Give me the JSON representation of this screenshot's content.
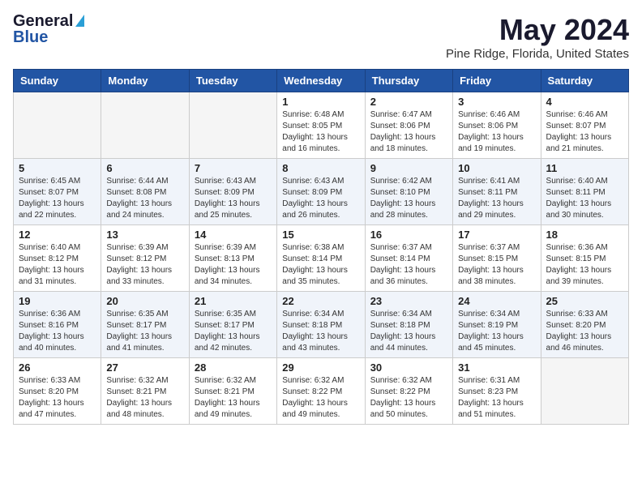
{
  "header": {
    "logo_general": "General",
    "logo_blue": "Blue",
    "month_title": "May 2024",
    "location": "Pine Ridge, Florida, United States"
  },
  "weekdays": [
    "Sunday",
    "Monday",
    "Tuesday",
    "Wednesday",
    "Thursday",
    "Friday",
    "Saturday"
  ],
  "weeks": [
    [
      {
        "day": "",
        "sunrise": "",
        "sunset": "",
        "daylight": "",
        "empty": true
      },
      {
        "day": "",
        "sunrise": "",
        "sunset": "",
        "daylight": "",
        "empty": true
      },
      {
        "day": "",
        "sunrise": "",
        "sunset": "",
        "daylight": "",
        "empty": true
      },
      {
        "day": "1",
        "sunrise": "Sunrise: 6:48 AM",
        "sunset": "Sunset: 8:05 PM",
        "daylight": "Daylight: 13 hours and 16 minutes."
      },
      {
        "day": "2",
        "sunrise": "Sunrise: 6:47 AM",
        "sunset": "Sunset: 8:06 PM",
        "daylight": "Daylight: 13 hours and 18 minutes."
      },
      {
        "day": "3",
        "sunrise": "Sunrise: 6:46 AM",
        "sunset": "Sunset: 8:06 PM",
        "daylight": "Daylight: 13 hours and 19 minutes."
      },
      {
        "day": "4",
        "sunrise": "Sunrise: 6:46 AM",
        "sunset": "Sunset: 8:07 PM",
        "daylight": "Daylight: 13 hours and 21 minutes."
      }
    ],
    [
      {
        "day": "5",
        "sunrise": "Sunrise: 6:45 AM",
        "sunset": "Sunset: 8:07 PM",
        "daylight": "Daylight: 13 hours and 22 minutes."
      },
      {
        "day": "6",
        "sunrise": "Sunrise: 6:44 AM",
        "sunset": "Sunset: 8:08 PM",
        "daylight": "Daylight: 13 hours and 24 minutes."
      },
      {
        "day": "7",
        "sunrise": "Sunrise: 6:43 AM",
        "sunset": "Sunset: 8:09 PM",
        "daylight": "Daylight: 13 hours and 25 minutes."
      },
      {
        "day": "8",
        "sunrise": "Sunrise: 6:43 AM",
        "sunset": "Sunset: 8:09 PM",
        "daylight": "Daylight: 13 hours and 26 minutes."
      },
      {
        "day": "9",
        "sunrise": "Sunrise: 6:42 AM",
        "sunset": "Sunset: 8:10 PM",
        "daylight": "Daylight: 13 hours and 28 minutes."
      },
      {
        "day": "10",
        "sunrise": "Sunrise: 6:41 AM",
        "sunset": "Sunset: 8:11 PM",
        "daylight": "Daylight: 13 hours and 29 minutes."
      },
      {
        "day": "11",
        "sunrise": "Sunrise: 6:40 AM",
        "sunset": "Sunset: 8:11 PM",
        "daylight": "Daylight: 13 hours and 30 minutes."
      }
    ],
    [
      {
        "day": "12",
        "sunrise": "Sunrise: 6:40 AM",
        "sunset": "Sunset: 8:12 PM",
        "daylight": "Daylight: 13 hours and 31 minutes."
      },
      {
        "day": "13",
        "sunrise": "Sunrise: 6:39 AM",
        "sunset": "Sunset: 8:12 PM",
        "daylight": "Daylight: 13 hours and 33 minutes."
      },
      {
        "day": "14",
        "sunrise": "Sunrise: 6:39 AM",
        "sunset": "Sunset: 8:13 PM",
        "daylight": "Daylight: 13 hours and 34 minutes."
      },
      {
        "day": "15",
        "sunrise": "Sunrise: 6:38 AM",
        "sunset": "Sunset: 8:14 PM",
        "daylight": "Daylight: 13 hours and 35 minutes."
      },
      {
        "day": "16",
        "sunrise": "Sunrise: 6:37 AM",
        "sunset": "Sunset: 8:14 PM",
        "daylight": "Daylight: 13 hours and 36 minutes."
      },
      {
        "day": "17",
        "sunrise": "Sunrise: 6:37 AM",
        "sunset": "Sunset: 8:15 PM",
        "daylight": "Daylight: 13 hours and 38 minutes."
      },
      {
        "day": "18",
        "sunrise": "Sunrise: 6:36 AM",
        "sunset": "Sunset: 8:15 PM",
        "daylight": "Daylight: 13 hours and 39 minutes."
      }
    ],
    [
      {
        "day": "19",
        "sunrise": "Sunrise: 6:36 AM",
        "sunset": "Sunset: 8:16 PM",
        "daylight": "Daylight: 13 hours and 40 minutes."
      },
      {
        "day": "20",
        "sunrise": "Sunrise: 6:35 AM",
        "sunset": "Sunset: 8:17 PM",
        "daylight": "Daylight: 13 hours and 41 minutes."
      },
      {
        "day": "21",
        "sunrise": "Sunrise: 6:35 AM",
        "sunset": "Sunset: 8:17 PM",
        "daylight": "Daylight: 13 hours and 42 minutes."
      },
      {
        "day": "22",
        "sunrise": "Sunrise: 6:34 AM",
        "sunset": "Sunset: 8:18 PM",
        "daylight": "Daylight: 13 hours and 43 minutes."
      },
      {
        "day": "23",
        "sunrise": "Sunrise: 6:34 AM",
        "sunset": "Sunset: 8:18 PM",
        "daylight": "Daylight: 13 hours and 44 minutes."
      },
      {
        "day": "24",
        "sunrise": "Sunrise: 6:34 AM",
        "sunset": "Sunset: 8:19 PM",
        "daylight": "Daylight: 13 hours and 45 minutes."
      },
      {
        "day": "25",
        "sunrise": "Sunrise: 6:33 AM",
        "sunset": "Sunset: 8:20 PM",
        "daylight": "Daylight: 13 hours and 46 minutes."
      }
    ],
    [
      {
        "day": "26",
        "sunrise": "Sunrise: 6:33 AM",
        "sunset": "Sunset: 8:20 PM",
        "daylight": "Daylight: 13 hours and 47 minutes."
      },
      {
        "day": "27",
        "sunrise": "Sunrise: 6:32 AM",
        "sunset": "Sunset: 8:21 PM",
        "daylight": "Daylight: 13 hours and 48 minutes."
      },
      {
        "day": "28",
        "sunrise": "Sunrise: 6:32 AM",
        "sunset": "Sunset: 8:21 PM",
        "daylight": "Daylight: 13 hours and 49 minutes."
      },
      {
        "day": "29",
        "sunrise": "Sunrise: 6:32 AM",
        "sunset": "Sunset: 8:22 PM",
        "daylight": "Daylight: 13 hours and 49 minutes."
      },
      {
        "day": "30",
        "sunrise": "Sunrise: 6:32 AM",
        "sunset": "Sunset: 8:22 PM",
        "daylight": "Daylight: 13 hours and 50 minutes."
      },
      {
        "day": "31",
        "sunrise": "Sunrise: 6:31 AM",
        "sunset": "Sunset: 8:23 PM",
        "daylight": "Daylight: 13 hours and 51 minutes."
      },
      {
        "day": "",
        "sunrise": "",
        "sunset": "",
        "daylight": "",
        "empty": true
      }
    ]
  ]
}
